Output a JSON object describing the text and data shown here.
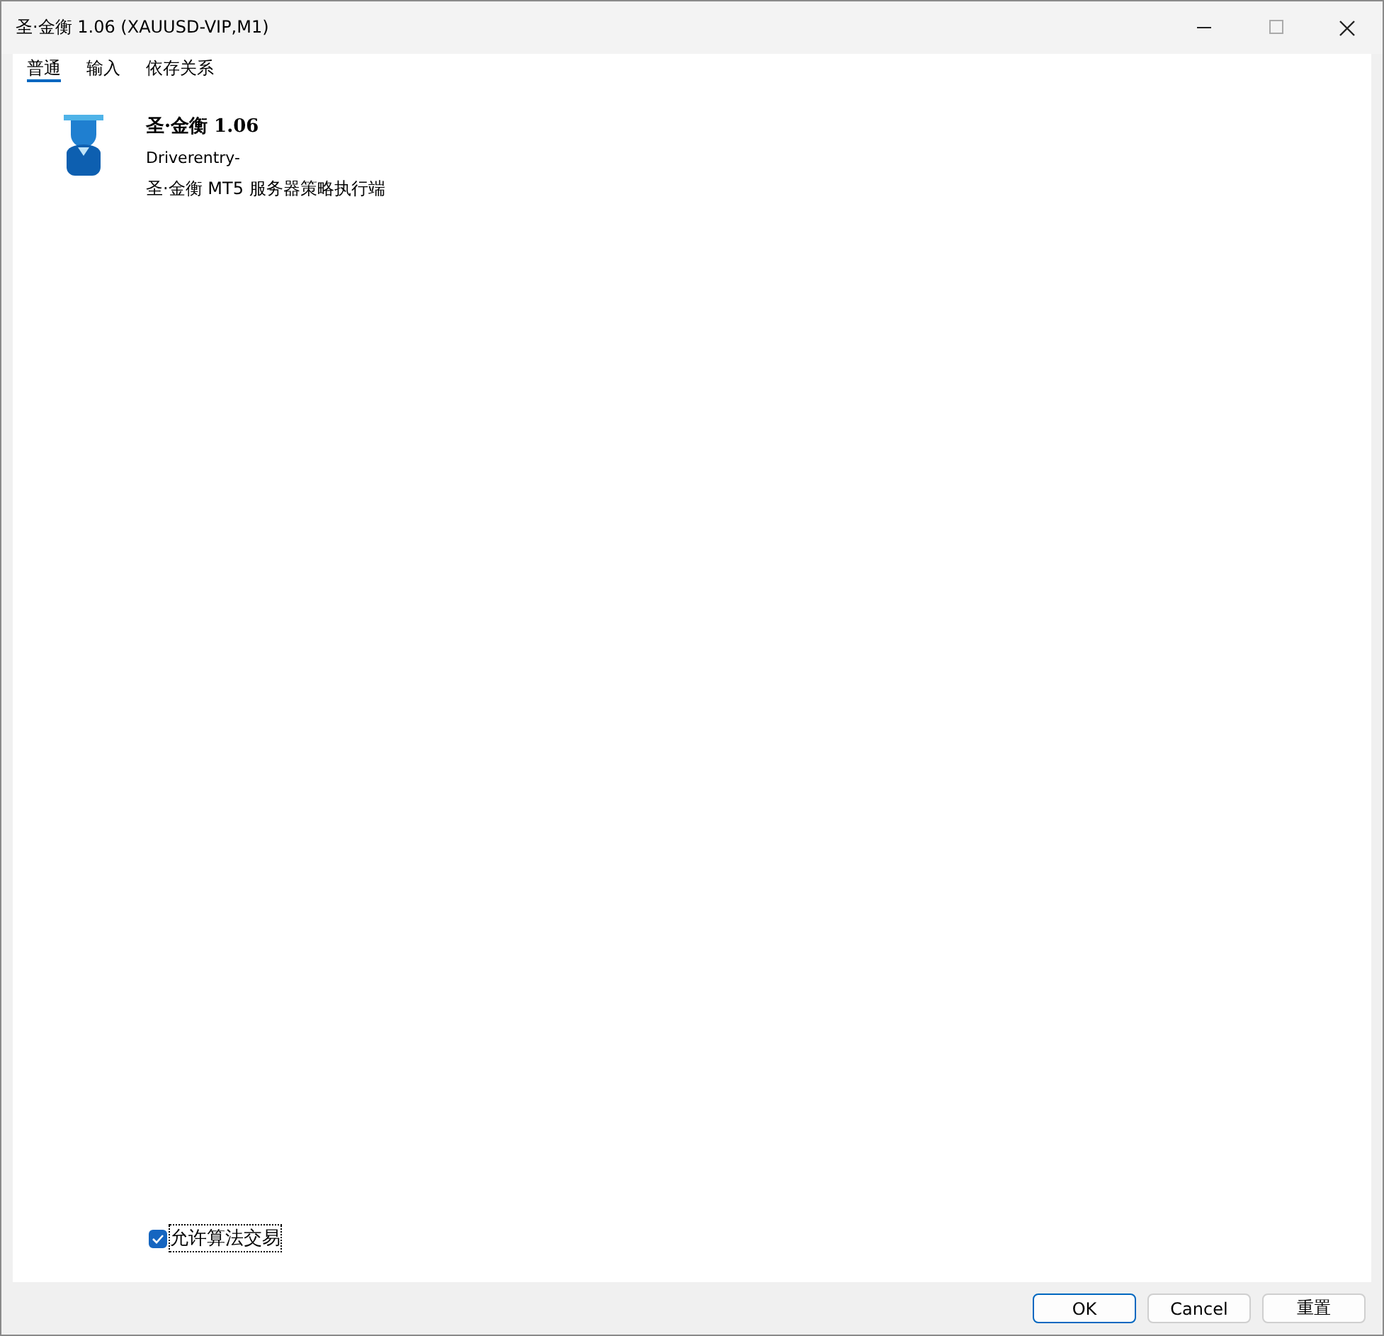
{
  "window": {
    "title": "圣·金衡 1.06 (XAUUSD-VIP,M1)"
  },
  "tabs": [
    {
      "label": "普通",
      "selected": true
    },
    {
      "label": "输入",
      "selected": false
    },
    {
      "label": "依存关系",
      "selected": false
    }
  ],
  "program": {
    "name": "圣·金衡 1.06",
    "author": "Driverentry-",
    "description": "圣·金衡 MT5 服务器策略执行端"
  },
  "allow_algo_trading": {
    "label": "允许算法交易",
    "checked": true
  },
  "buttons": [
    {
      "label": "OK",
      "kind": "default"
    },
    {
      "label": "Cancel",
      "kind": "normal"
    },
    {
      "label": "重置",
      "kind": "normal"
    }
  ]
}
